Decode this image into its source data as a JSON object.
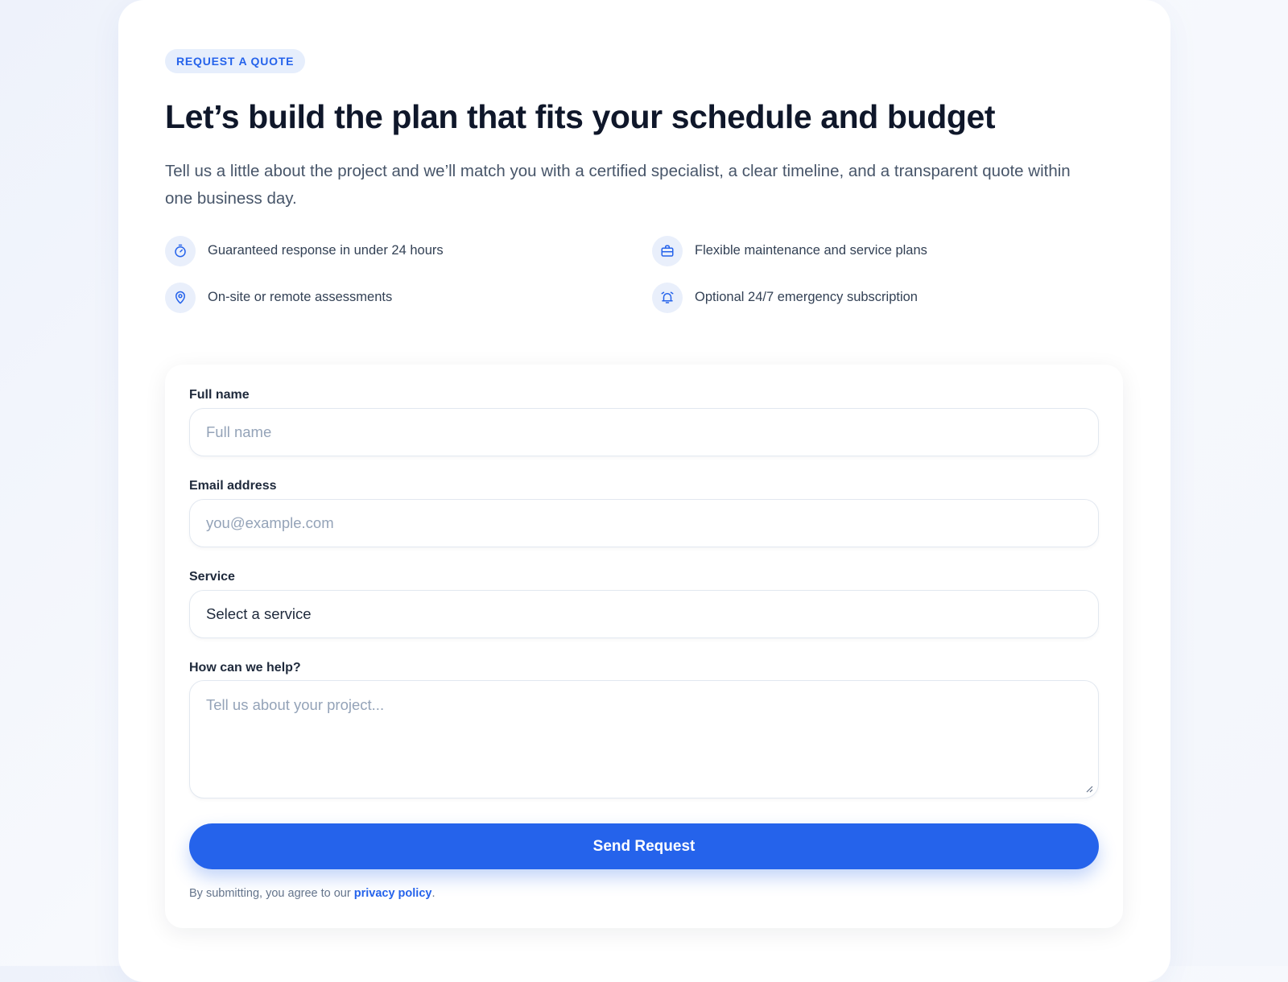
{
  "eyebrow": "REQUEST A QUOTE",
  "headline": "Let’s build the plan that fits your schedule and budget",
  "intro": "Tell us a little about the project and we’ll match you with a certified specialist, a clear timeline, and a transparent quote within one business day.",
  "features": [
    {
      "icon": "stopwatch-icon",
      "text": "Guaranteed response in under 24 hours"
    },
    {
      "icon": "briefcase-icon",
      "text": "Flexible maintenance and service plans"
    },
    {
      "icon": "map-pin-icon",
      "text": "On-site or remote assessments"
    },
    {
      "icon": "alarm-bell-icon",
      "text": "Optional 24/7 emergency subscription"
    }
  ],
  "form": {
    "full_name": {
      "label": "Full name",
      "placeholder": "Full name",
      "value": ""
    },
    "email": {
      "label": "Email address",
      "placeholder": "you@example.com",
      "value": ""
    },
    "service": {
      "label": "Service",
      "selected": "Select a service"
    },
    "message": {
      "label": "How can we help?",
      "placeholder": "Tell us about your project...",
      "value": ""
    },
    "submit_label": "Send Request",
    "disclaimer_prefix": "By submitting, you agree to our ",
    "privacy_link": "privacy policy",
    "disclaimer_suffix": "."
  },
  "colors": {
    "accent": "#2563eb",
    "heading": "#0f172a",
    "body": "#475569",
    "chip_background": "#e6eefc"
  }
}
